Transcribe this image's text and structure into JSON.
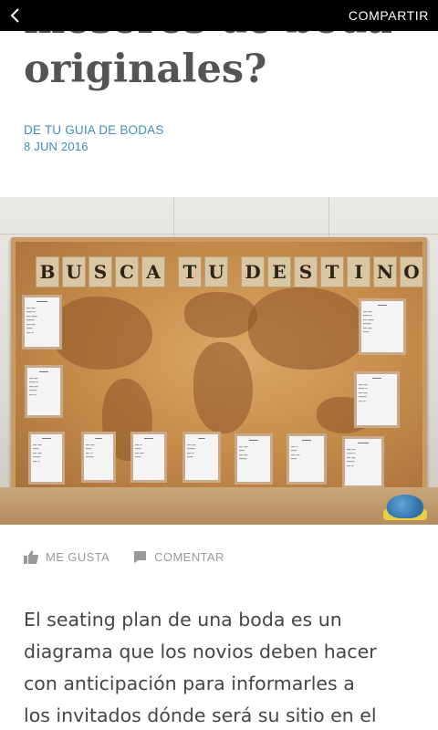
{
  "topbar": {
    "back_icon": "chevron-left-icon",
    "share_label": "COMPARTIR"
  },
  "article": {
    "title_lines": [
      "meseros de boda",
      "originales?"
    ],
    "source": "DE TU GUIA DE BODAS",
    "date": "8 JUN 2016"
  },
  "photo": {
    "banner_text": "BUSCA TU DESTINO"
  },
  "actions": {
    "like_label": "ME GUSTA",
    "like_icon": "thumbs-up-icon",
    "comment_label": "COMENTAR",
    "comment_icon": "comment-bubble-icon"
  },
  "body": {
    "lines": [
      "El seating plan de una boda  es un",
      "diagrama que los novios deben hacer",
      "con anticipación para informarles a",
      "los invitados dónde será su sitio en el"
    ]
  },
  "colors": {
    "accent": "#3f8fb5",
    "title": "#545454",
    "muted": "#9a9a9a",
    "topbar": "#000000"
  }
}
